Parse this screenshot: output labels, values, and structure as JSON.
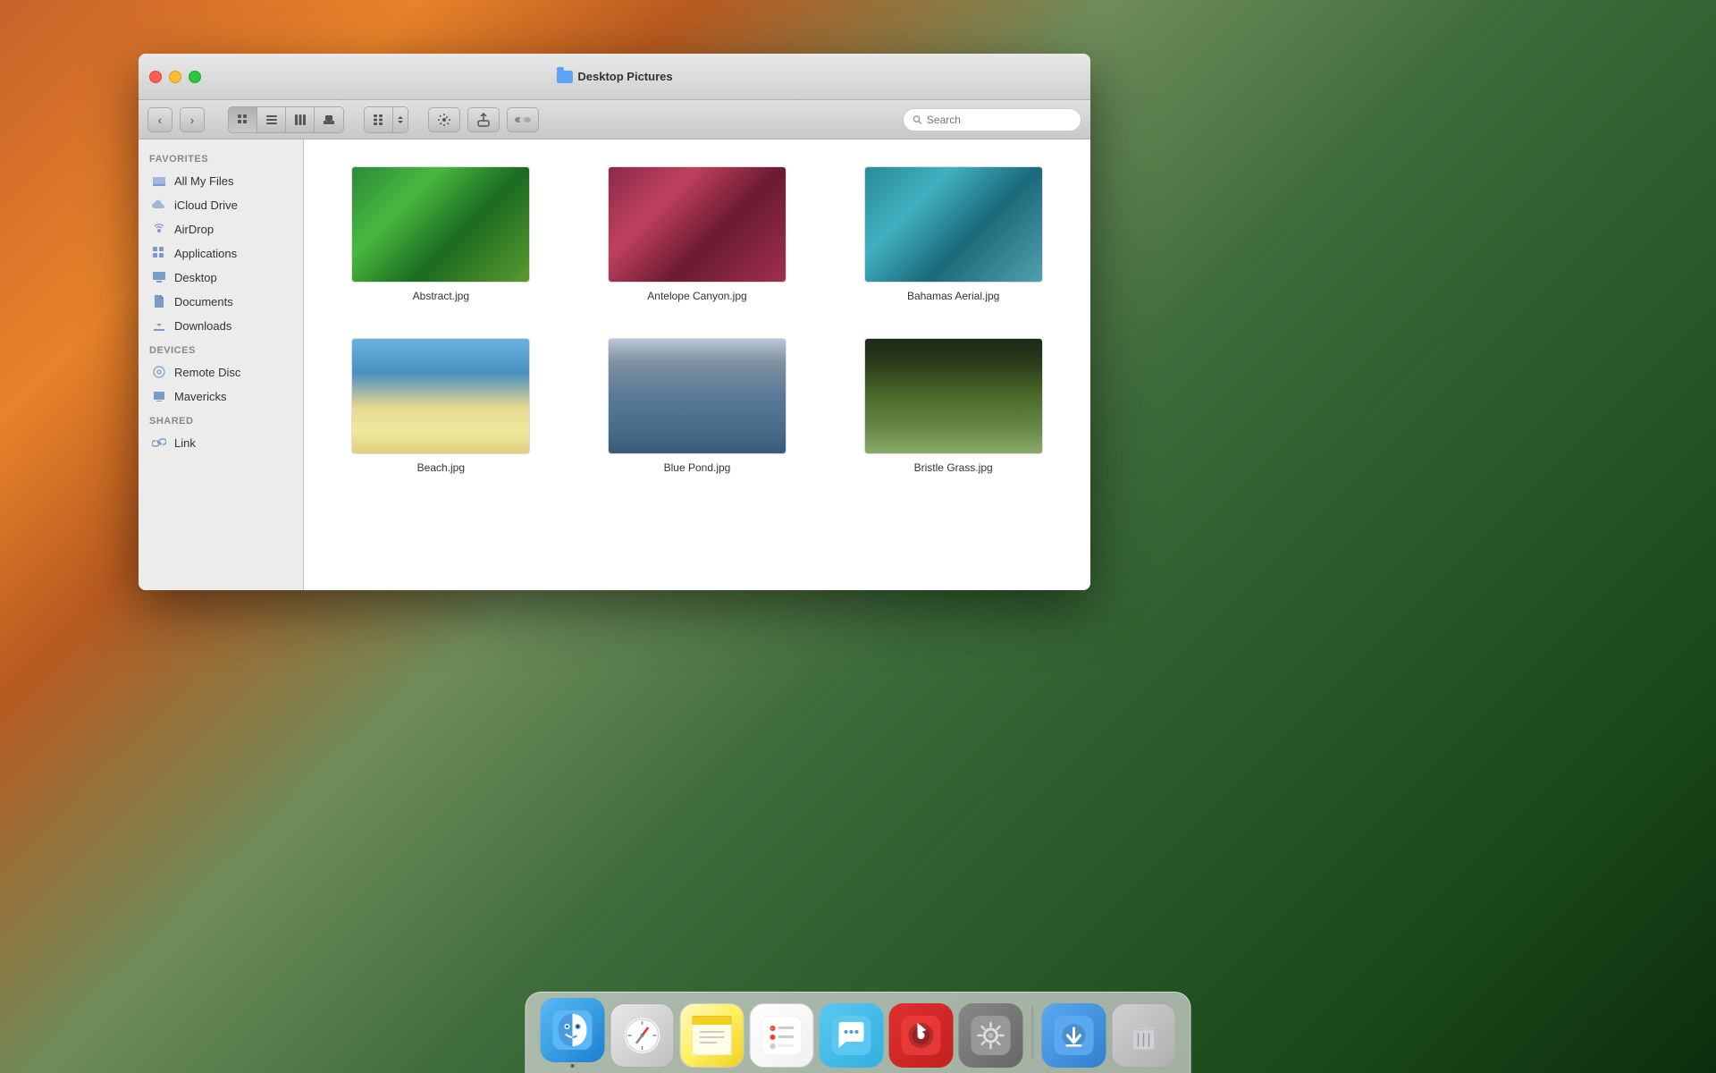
{
  "window": {
    "title": "Desktop Pictures",
    "traffic_lights": {
      "close_label": "close",
      "minimize_label": "minimize",
      "maximize_label": "maximize"
    }
  },
  "toolbar": {
    "back_label": "‹",
    "forward_label": "›",
    "view_icon": "⊞",
    "list_icon": "≡",
    "column_icon": "⫿",
    "cover_icon": "◫",
    "grid_icon": "⊞",
    "action_icon": "⚙",
    "share_icon": "↑",
    "tag_icon": "⬬",
    "search_placeholder": "Search"
  },
  "sidebar": {
    "favorites_label": "Favorites",
    "devices_label": "Devices",
    "shared_label": "Shared",
    "items": {
      "favorites": [
        {
          "id": "all-my-files",
          "label": "All My Files",
          "icon": "📁"
        },
        {
          "id": "icloud-drive",
          "label": "iCloud Drive",
          "icon": "☁"
        },
        {
          "id": "airdrop",
          "label": "AirDrop",
          "icon": "📡"
        },
        {
          "id": "applications",
          "label": "Applications",
          "icon": "⌂"
        },
        {
          "id": "desktop",
          "label": "Desktop",
          "icon": "🖥"
        },
        {
          "id": "documents",
          "label": "Documents",
          "icon": "📄"
        },
        {
          "id": "downloads",
          "label": "Downloads",
          "icon": "⬇"
        }
      ],
      "devices": [
        {
          "id": "remote-disc",
          "label": "Remote Disc",
          "icon": "💿"
        },
        {
          "id": "mavericks",
          "label": "Mavericks",
          "icon": "🖱"
        }
      ],
      "shared": [
        {
          "id": "link",
          "label": "Link",
          "icon": "🔗"
        }
      ]
    }
  },
  "files": [
    {
      "id": "abstract",
      "name": "Abstract.jpg",
      "thumb_class": "thumb-abstract"
    },
    {
      "id": "antelope-canyon",
      "name": "Antelope Canyon.jpg",
      "thumb_class": "thumb-antelope"
    },
    {
      "id": "bahamas-aerial",
      "name": "Bahamas Aerial.jpg",
      "thumb_class": "thumb-bahamas"
    },
    {
      "id": "beach",
      "name": "Beach.jpg",
      "thumb_class": "thumb-beach"
    },
    {
      "id": "blue-pond",
      "name": "Blue Pond.jpg",
      "thumb_class": "thumb-bluepond"
    },
    {
      "id": "bristle-grass",
      "name": "Bristle Grass.jpg",
      "thumb_class": "thumb-bristle"
    }
  ],
  "dock": {
    "items": [
      {
        "id": "finder",
        "label": "Finder",
        "icon_class": "dock-finder",
        "has_dot": true,
        "icon_symbol": "🔵"
      },
      {
        "id": "safari",
        "label": "Safari",
        "icon_class": "dock-safari",
        "has_dot": false,
        "icon_symbol": "🧭"
      },
      {
        "id": "notes",
        "label": "Notes",
        "icon_class": "dock-notes",
        "has_dot": false,
        "icon_symbol": "📝"
      },
      {
        "id": "reminders",
        "label": "Reminders",
        "icon_class": "dock-reminders",
        "has_dot": false,
        "icon_symbol": "📋"
      },
      {
        "id": "messages",
        "label": "Messages",
        "icon_class": "dock-messages",
        "has_dot": false,
        "icon_symbol": "💬"
      },
      {
        "id": "itunes",
        "label": "iTunes",
        "icon_class": "dock-itunes",
        "has_dot": false,
        "icon_symbol": "♪"
      },
      {
        "id": "system-preferences",
        "label": "System Preferences",
        "icon_class": "dock-sysprefs",
        "has_dot": false,
        "icon_symbol": "⚙"
      },
      {
        "id": "downloads-folder",
        "label": "Downloads",
        "icon_class": "dock-downloads",
        "has_dot": false,
        "icon_symbol": "⬇"
      },
      {
        "id": "trash",
        "label": "Trash",
        "icon_class": "dock-trash",
        "has_dot": false,
        "icon_symbol": "🗑"
      }
    ]
  }
}
